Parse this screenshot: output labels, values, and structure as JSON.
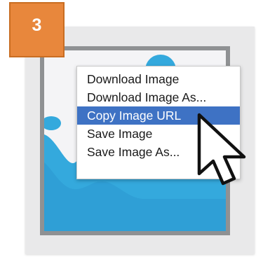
{
  "step": {
    "number": "3",
    "color": "#e8873c"
  },
  "context_menu": {
    "items": [
      {
        "label": "Download Image",
        "selected": false
      },
      {
        "label": "Download Image As...",
        "selected": false
      },
      {
        "label": "Copy Image URL",
        "selected": true
      },
      {
        "label": "Save Image",
        "selected": false
      },
      {
        "label": "Save Image As...",
        "selected": false
      }
    ],
    "highlight_color": "#3e72c4"
  },
  "cursor": {
    "icon": "arrow-pointer-icon"
  }
}
